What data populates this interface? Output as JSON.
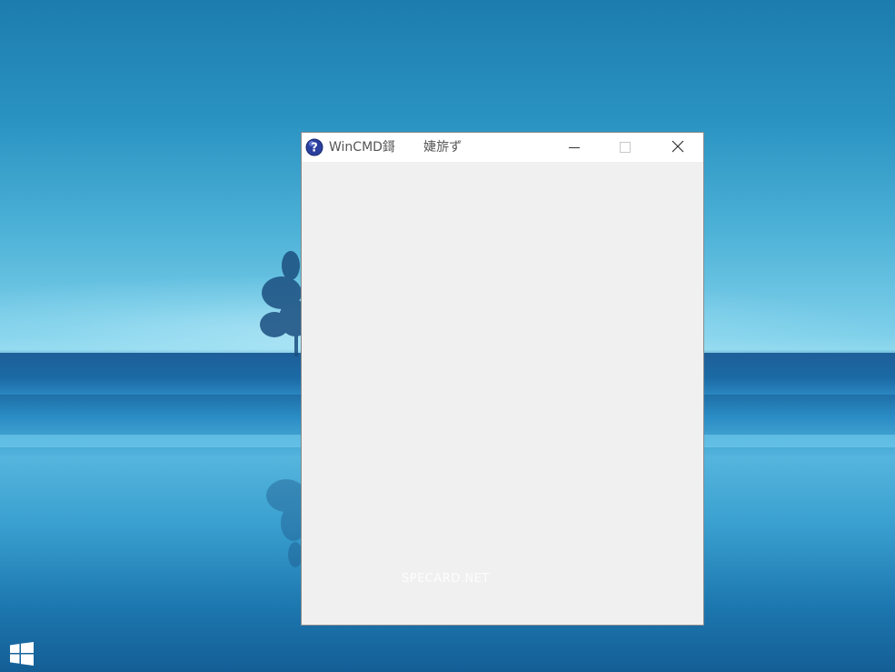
{
  "window": {
    "title": "WinCMD鎶       婕旂ず",
    "icon": "help-question-icon",
    "controls": {
      "minimize": "minimize-icon",
      "maximize": "maximize-icon",
      "close": "close-icon"
    }
  },
  "watermark": {
    "text": "SPECARD.NET"
  },
  "taskbar": {
    "start_icon": "windows-logo-icon"
  },
  "colors": {
    "window_bg": "#f0f0f0",
    "titlebar_bg": "#ffffff",
    "title_text": "#555555",
    "icon_blue": "#2b3f9e",
    "desktop_sky": "#2a93c2"
  }
}
